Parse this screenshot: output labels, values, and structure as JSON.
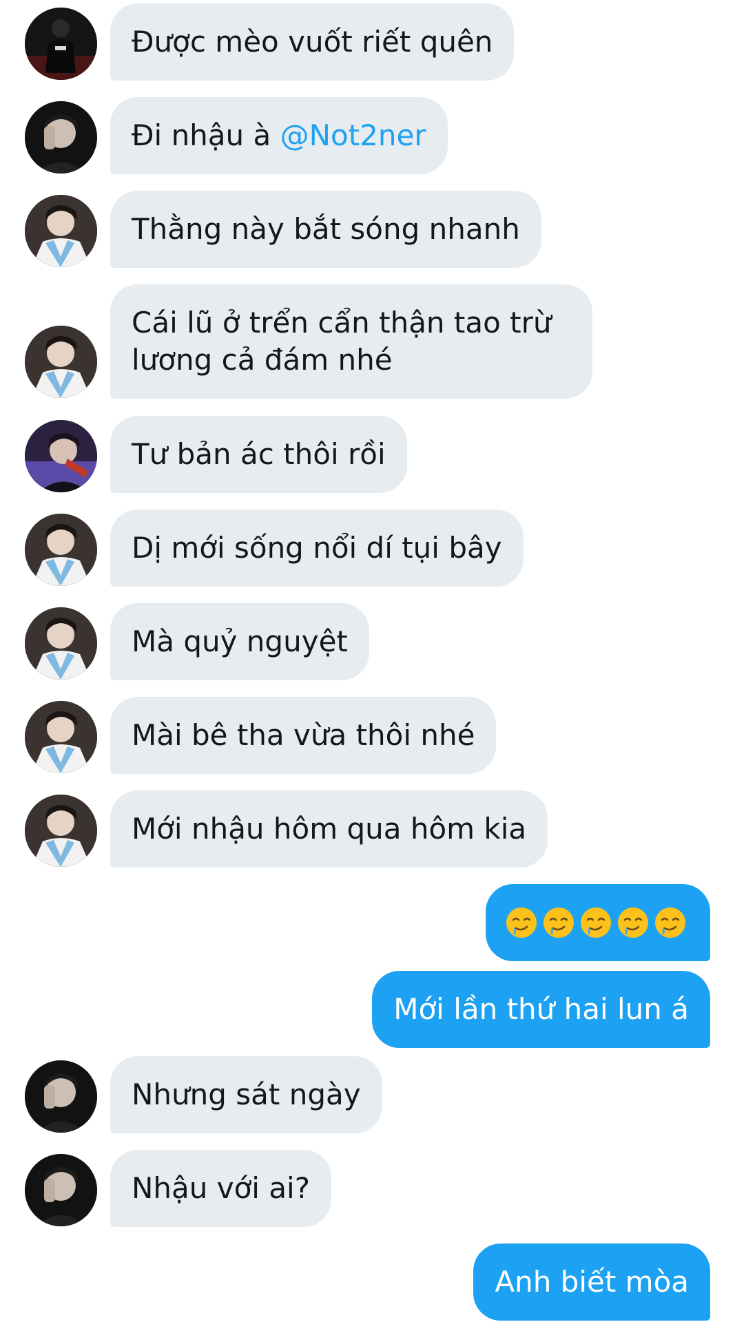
{
  "colors": {
    "incoming_bubble": "#e6ecf0",
    "outgoing_bubble": "#1da1f2",
    "mention": "#1da1f2",
    "text_dark": "#14171a"
  },
  "messages": [
    {
      "direction": "in",
      "avatar": "avatar-user-dark",
      "text": "Được mèo vuốt riết quên"
    },
    {
      "direction": "in",
      "avatar": "avatar-user-hand",
      "text": "Đi nhậu à ",
      "mention": "@Not2ner"
    },
    {
      "direction": "in",
      "avatar": "avatar-user-blue",
      "text": "Thằng này bắt sóng nhanh"
    },
    {
      "direction": "in",
      "avatar": "avatar-user-blue",
      "lines": [
        "Cái lũ ở trển cẩn thận tao trừ",
        "lương cả đám nhé"
      ]
    },
    {
      "direction": "in",
      "avatar": "avatar-user-purple",
      "text": "Tư bản ác thôi rồi"
    },
    {
      "direction": "in",
      "avatar": "avatar-user-blue",
      "text": "Dị mới sống nổi dí tụi bây"
    },
    {
      "direction": "in",
      "avatar": "avatar-user-blue",
      "text": "Mà quỷ nguyệt"
    },
    {
      "direction": "in",
      "avatar": "avatar-user-blue",
      "text": "Mài bê tha vừa thôi nhé"
    },
    {
      "direction": "in",
      "avatar": "avatar-user-blue",
      "text": "Mới nhậu hôm qua hôm kia"
    },
    {
      "direction": "out",
      "emoji": "drooling-face-emoji",
      "emoji_count": 5
    },
    {
      "direction": "out",
      "text": "Mới lần thứ hai lun á"
    },
    {
      "direction": "in",
      "avatar": "avatar-user-hand",
      "text": "Nhưng sát ngày"
    },
    {
      "direction": "in",
      "avatar": "avatar-user-hand",
      "text": "Nhậu với ai?"
    },
    {
      "direction": "out",
      "text": "Anh biết mòa"
    }
  ]
}
